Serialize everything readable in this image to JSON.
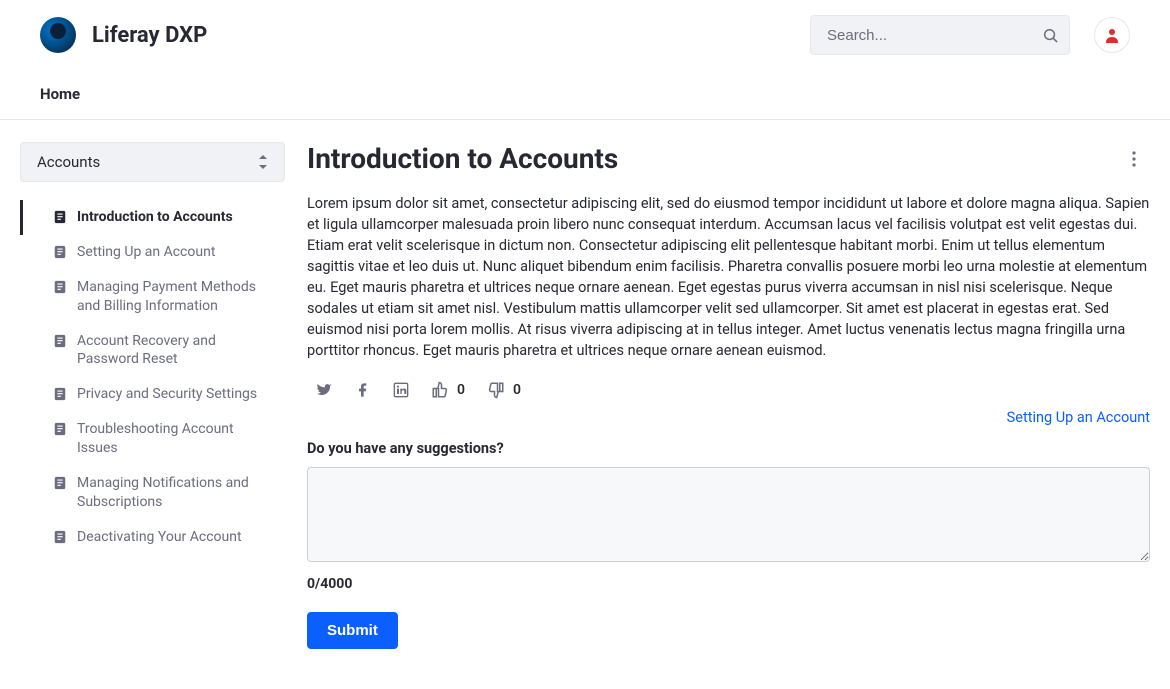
{
  "site": {
    "title": "Liferay DXP"
  },
  "header": {
    "search_placeholder": "Search..."
  },
  "nav": {
    "home_label": "Home"
  },
  "sidebar": {
    "category_label": "Accounts",
    "items": [
      {
        "label": "Introduction to Accounts",
        "active": true
      },
      {
        "label": "Setting Up an Account",
        "active": false
      },
      {
        "label": "Managing Payment Methods and Billing Information",
        "active": false
      },
      {
        "label": "Account Recovery and Password Reset",
        "active": false
      },
      {
        "label": "Privacy and Security Settings",
        "active": false
      },
      {
        "label": "Troubleshooting Account Issues",
        "active": false
      },
      {
        "label": "Managing Notifications and Subscriptions",
        "active": false
      },
      {
        "label": "Deactivating Your Account",
        "active": false
      }
    ]
  },
  "article": {
    "title": "Introduction to Accounts",
    "body": "Lorem ipsum dolor sit amet, consectetur adipiscing elit, sed do eiusmod tempor incididunt ut labore et dolore magna aliqua. Sapien et ligula ullamcorper malesuada proin libero nunc consequat interdum. Accumsan lacus vel facilisis volutpat est velit egestas dui. Etiam erat velit scelerisque in dictum non. Consectetur adipiscing elit pellentesque habitant morbi. Enim ut tellus elementum sagittis vitae et leo duis ut. Nunc aliquet bibendum enim facilisis. Pharetra convallis posuere morbi leo urna molestie at elementum eu. Eget mauris pharetra et ultrices neque ornare aenean. Eget egestas purus viverra accumsan in nisl nisi scelerisque. Neque sodales ut etiam sit amet nisl. Vestibulum mattis ullamcorper velit sed ullamcorper. Sit amet est placerat in egestas erat. Sed euismod nisi porta lorem mollis. At risus viverra adipiscing at in tellus integer. Amet luctus venenatis lectus magna fringilla urna porttitor rhoncus. Eget mauris pharetra et ultrices neque ornare aenean euismod.",
    "likes": "0",
    "dislikes": "0",
    "next_label": "Setting Up an Account"
  },
  "form": {
    "prompt": "Do you have any suggestions?",
    "counter": "0/4000",
    "submit_label": "Submit"
  }
}
